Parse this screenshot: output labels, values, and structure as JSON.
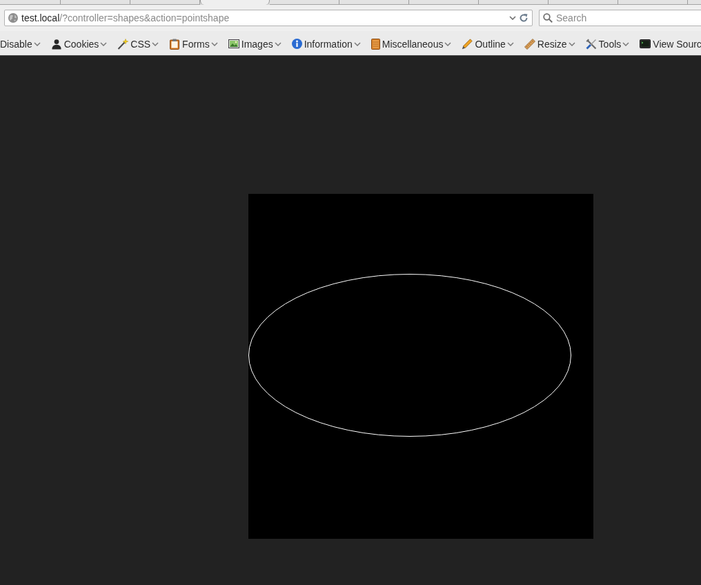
{
  "tabs": [
    {
      "selected": false
    },
    {
      "selected": false
    },
    {
      "selected": false
    },
    {
      "selected": true
    },
    {
      "selected": false
    },
    {
      "selected": false
    },
    {
      "selected": false
    },
    {
      "selected": false
    },
    {
      "selected": false
    },
    {
      "selected": false
    },
    {
      "selected": false
    }
  ],
  "address_bar": {
    "host": "test.local",
    "path": "/?controller=shapes&action=pointshape"
  },
  "search": {
    "placeholder": "Search"
  },
  "toolbar": [
    {
      "label": "Disable"
    },
    {
      "label": "Cookies"
    },
    {
      "label": "CSS"
    },
    {
      "label": "Forms"
    },
    {
      "label": "Images"
    },
    {
      "label": "Information"
    },
    {
      "label": "Miscellaneous"
    },
    {
      "label": "Outline"
    },
    {
      "label": "Resize"
    },
    {
      "label": "Tools"
    },
    {
      "label": "View Sourc"
    }
  ],
  "canvas": {
    "shapes": [
      {
        "kind": "ellipse"
      }
    ]
  }
}
